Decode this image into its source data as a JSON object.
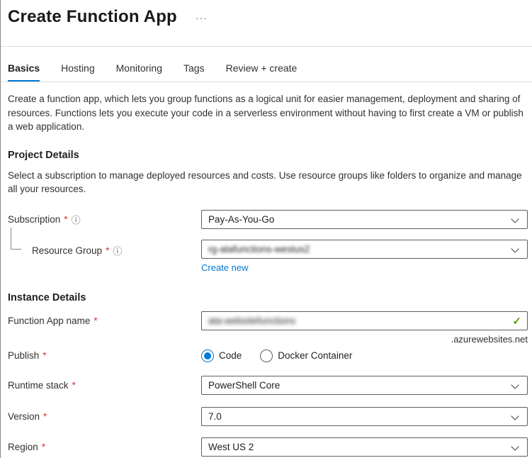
{
  "icons": {
    "ellipsis": "···",
    "info": "ⓘ",
    "check": "✓"
  },
  "required_mark": "*",
  "header": {
    "title": "Create Function App"
  },
  "tabs": {
    "basics": "Basics",
    "hosting": "Hosting",
    "monitoring": "Monitoring",
    "tags": "Tags",
    "review": "Review + create"
  },
  "intro": "Create a function app, which lets you group functions as a logical unit for easier management, deployment and sharing of resources. Functions lets you execute your code in a serverless environment without having to first create a VM or publish a web application.",
  "project": {
    "heading": "Project Details",
    "description": "Select a subscription to manage deployed resources and costs. Use resource groups like folders to organize and manage all your resources.",
    "subscription_label": "Subscription",
    "subscription_value": "Pay-As-You-Go",
    "resource_group_label": "Resource Group",
    "resource_group_value": "rg-atafunctions-westus2",
    "create_new": "Create new"
  },
  "instance": {
    "heading": "Instance Details",
    "app_name_label": "Function App name",
    "app_name_value": "ata-websitefunctions",
    "domain_suffix": ".azurewebsites.net",
    "publish_label": "Publish",
    "publish_code": "Code",
    "publish_docker": "Docker Container",
    "runtime_label": "Runtime stack",
    "runtime_value": "PowerShell Core",
    "version_label": "Version",
    "version_value": "7.0",
    "region_label": "Region",
    "region_value": "West US 2"
  },
  "colors": {
    "accent": "#0078d4",
    "required": "#d13438",
    "valid": "#57a300"
  }
}
